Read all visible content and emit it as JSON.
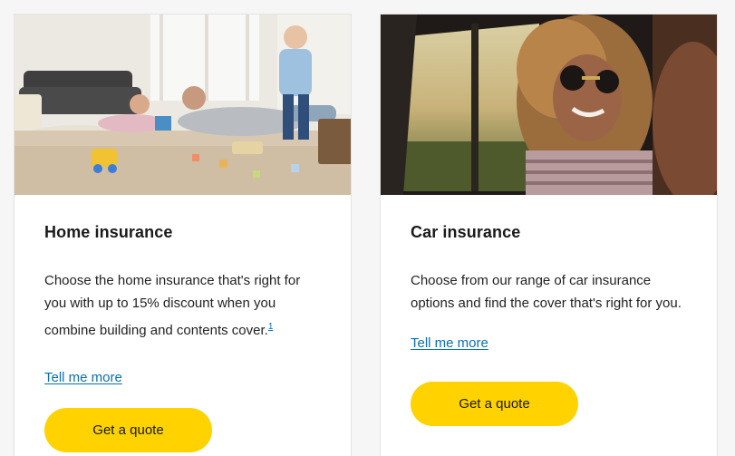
{
  "cards": [
    {
      "title": "Home insurance",
      "description": "Choose the home insurance that's right for you with up to 15% discount when you combine building and contents cover.",
      "footnote": "1",
      "link_label": "Tell me more",
      "button_label": "Get a quote",
      "image": "family-playing-on-living-room-floor"
    },
    {
      "title": "Car insurance",
      "description": "Choose from our range of car insurance options and find the cover that's right for you.",
      "link_label": "Tell me more",
      "button_label": "Get a quote",
      "image": "smiling-woman-in-car-with-sunglasses"
    }
  ],
  "colors": {
    "button": "#ffd200",
    "link": "#0a6fb0",
    "card_background": "#ffffff",
    "page_background": "#f6f6f6"
  }
}
